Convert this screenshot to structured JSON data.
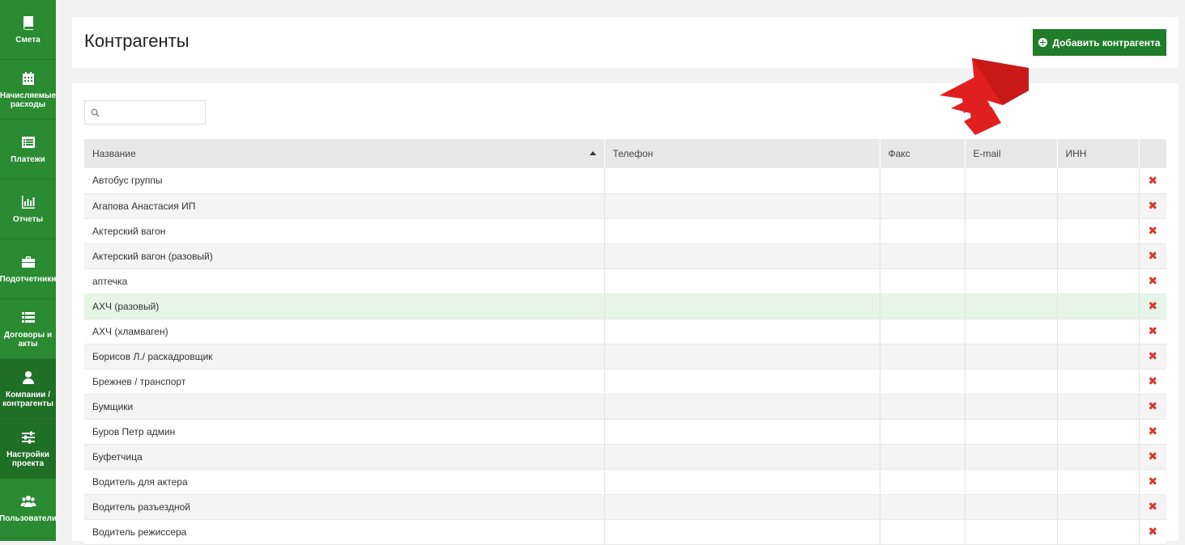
{
  "sidebar": {
    "items": [
      {
        "label": "Смета",
        "icon": "book-icon"
      },
      {
        "label": "Начисляемые расходы",
        "icon": "calendar-icon"
      },
      {
        "label": "Платежи",
        "icon": "list-icon"
      },
      {
        "label": "Отчеты",
        "icon": "bar-chart-icon"
      },
      {
        "label": "Подотчетники",
        "icon": "briefcase-icon"
      },
      {
        "label": "Договоры и акты",
        "icon": "list-icon"
      },
      {
        "label": "Компании / контрагенты",
        "icon": "user-icon"
      },
      {
        "label": "Настройки проекта",
        "icon": "sliders-icon"
      },
      {
        "label": "Пользователи",
        "icon": "users-icon"
      }
    ]
  },
  "header": {
    "title": "Контрагенты",
    "add_button_label": "Добавить контрагента"
  },
  "search": {
    "placeholder": "",
    "value": ""
  },
  "table": {
    "columns": [
      "Название",
      "Телефон",
      "Факс",
      "E-mail",
      "ИНН"
    ],
    "sort_column": "Название",
    "sort_direction": "asc",
    "rows": [
      {
        "name": "Автобус группы",
        "phone": "",
        "fax": "",
        "email": "",
        "inn": ""
      },
      {
        "name": "Агапова Анастасия ИП",
        "phone": "",
        "fax": "",
        "email": "",
        "inn": ""
      },
      {
        "name": "Актерский вагон",
        "phone": "",
        "fax": "",
        "email": "",
        "inn": ""
      },
      {
        "name": "Актерский вагон (разовый)",
        "phone": "",
        "fax": "",
        "email": "",
        "inn": ""
      },
      {
        "name": "аптечка",
        "phone": "",
        "fax": "",
        "email": "",
        "inn": ""
      },
      {
        "name": "АХЧ (разовый)",
        "phone": "",
        "fax": "",
        "email": "",
        "inn": "",
        "highlighted": true
      },
      {
        "name": "АХЧ (хламваген)",
        "phone": "",
        "fax": "",
        "email": "",
        "inn": ""
      },
      {
        "name": "Борисов Л./ раскадровщик",
        "phone": "",
        "fax": "",
        "email": "",
        "inn": ""
      },
      {
        "name": "Брежнев / транспорт",
        "phone": "",
        "fax": "",
        "email": "",
        "inn": ""
      },
      {
        "name": "Бумщики",
        "phone": "",
        "fax": "",
        "email": "",
        "inn": ""
      },
      {
        "name": "Буров Петр админ",
        "phone": "",
        "fax": "",
        "email": "",
        "inn": ""
      },
      {
        "name": "Буфетчица",
        "phone": "",
        "fax": "",
        "email": "",
        "inn": ""
      },
      {
        "name": "Водитель для актера",
        "phone": "",
        "fax": "",
        "email": "",
        "inn": ""
      },
      {
        "name": "Водитель разъездной",
        "phone": "",
        "fax": "",
        "email": "",
        "inn": ""
      },
      {
        "name": "Водитель режиссера",
        "phone": "",
        "fax": "",
        "email": "",
        "inn": ""
      }
    ],
    "delete_icon": "close-icon"
  },
  "colors": {
    "sidebar": "#2a8b32",
    "sidebar_active": "#1f6f26",
    "button": "#1f7d29",
    "delete": "#d9372b",
    "row_highlight": "#e7f5e7",
    "arrow": "#e02020"
  }
}
